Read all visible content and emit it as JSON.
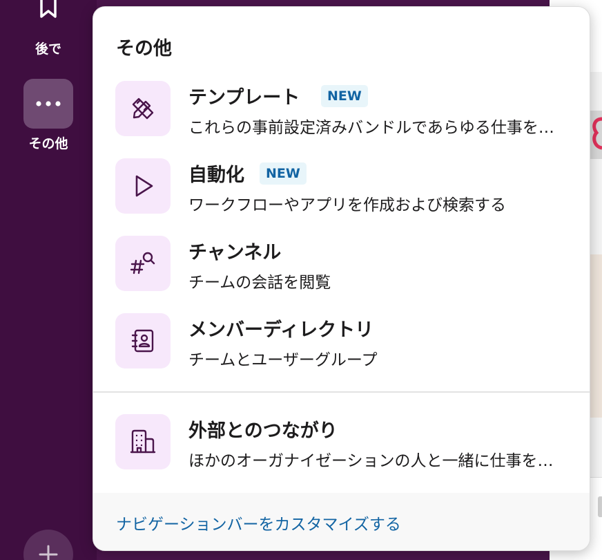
{
  "sidebar": {
    "later_label": "後で",
    "more_label": "その他"
  },
  "menu": {
    "title": "その他",
    "items": [
      {
        "title": "テンプレート",
        "badge": "NEW",
        "description": "これらの事前設定済みバンドルであらゆる仕事を…",
        "icon": "pencil-ruler-icon"
      },
      {
        "title": "自動化",
        "badge": "NEW",
        "description": "ワークフローやアプリを作成および検索する",
        "icon": "play-icon"
      },
      {
        "title": "チャンネル",
        "description": "チームの会話を閲覧",
        "icon": "channel-search-icon"
      },
      {
        "title": "メンバーディレクトリ",
        "description": "チームとユーザーグループ",
        "icon": "contact-book-icon"
      }
    ],
    "external": {
      "title": "外部とのつながり",
      "description": "ほかのオーガナイゼーションの人と一緒に仕事をする",
      "icon": "building-icon"
    },
    "footer_link": "ナビゲーションバーをカスタマイズする"
  },
  "colors": {
    "sidebar_bg": "#3f0e40",
    "accent_link": "#1264a3",
    "badge_bg": "#e8f5fa",
    "icon_tile_bg": "#f7e8fb",
    "icon_stroke": "#4a154b"
  }
}
